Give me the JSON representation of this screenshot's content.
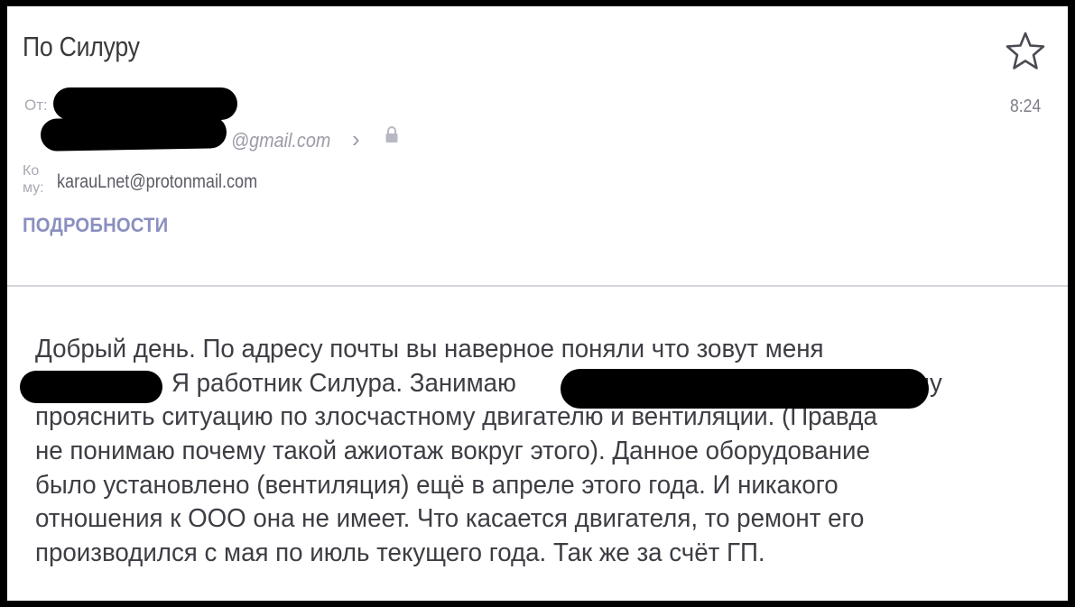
{
  "email": {
    "subject": "По Силуру",
    "from_label": "От:",
    "sender_suffix": "@gmail.com",
    "time": "8:24",
    "to_label": "Ко му:",
    "to_address": "karauLnet@protonmail.com",
    "details_label": "ПОДРОБНОСТИ"
  },
  "body": {
    "line1": "Добрый день. По адресу почты вы наверное поняли что зовут меня",
    "line2a": "Я работник Силура. Занимаю",
    "line2b": "Хочу",
    "line3": "прояснить ситуацию по злосчастному двигателю и вентиляции. (Правда",
    "line4": "не понимаю почему такой ажиотаж вокруг этого). Данное оборудование",
    "line5": "было установлено (вентиляция) ещё в апреле этого года. И никакого",
    "line6": "отношения к ООО она не имеет. Что касается двигателя, то ремонт его",
    "line7": "производился с мая по июль текущего года. Так же за счёт ГП."
  },
  "icons": {
    "star": "star-outline-icon",
    "chevron": "chevron-right-icon",
    "lock": "lock-icon"
  },
  "colors": {
    "details_accent": "#8a8fbf",
    "redaction": "#000000"
  }
}
